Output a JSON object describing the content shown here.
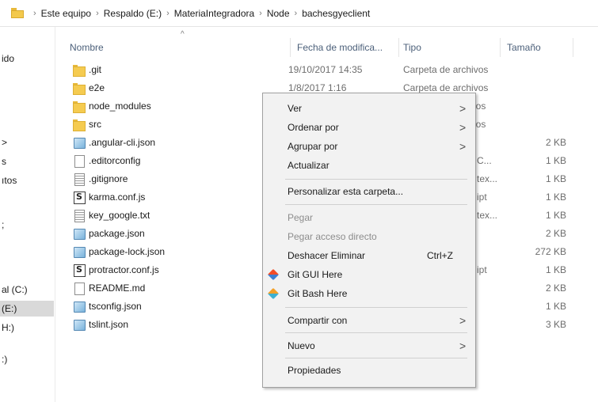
{
  "breadcrumb": {
    "items": [
      "Este equipo",
      "Respaldo (E:)",
      "MateriaIntegradora",
      "Node",
      "bachesgyeclient"
    ]
  },
  "nav": {
    "items": [
      "ido",
      ">",
      "s",
      "ıtos",
      ";",
      "al (C:)",
      "(E:)",
      "H:)",
      ":)"
    ]
  },
  "columns": {
    "name": "Nombre",
    "date": "Fecha de modifica...",
    "type": "Tipo",
    "size": "Tamaño"
  },
  "files": [
    {
      "name": ".git",
      "date": "19/10/2017 14:35",
      "type": "Carpeta de archivos",
      "size": "",
      "icon": "folder-icon"
    },
    {
      "name": "e2e",
      "date": "1/8/2017 1:16",
      "type": "Carpeta de archivos",
      "size": "",
      "icon": "folder-icon"
    },
    {
      "name": "node_modules",
      "date": "",
      "type": "ivos",
      "size": "",
      "icon": "folder-icon"
    },
    {
      "name": "src",
      "date": "",
      "type": "ivos",
      "size": "",
      "icon": "folder-icon"
    },
    {
      "name": ".angular-cli.json",
      "date": "",
      "type": "",
      "size": "2 KB",
      "icon": "json-file-icon"
    },
    {
      "name": ".editorconfig",
      "date": "",
      "type": "C...",
      "size": "1 KB",
      "icon": "file-icon"
    },
    {
      "name": ".gitignore",
      "date": "",
      "type": "tex...",
      "size": "1 KB",
      "icon": "text-file-icon"
    },
    {
      "name": "karma.conf.js",
      "date": "",
      "type": "ipt",
      "size": "1 KB",
      "icon": "js-file-icon"
    },
    {
      "name": "key_google.txt",
      "date": "",
      "type": "tex...",
      "size": "1 KB",
      "icon": "text-file-icon"
    },
    {
      "name": "package.json",
      "date": "",
      "type": "",
      "size": "2 KB",
      "icon": "json-file-icon"
    },
    {
      "name": "package-lock.json",
      "date": "",
      "type": "",
      "size": "272 KB",
      "icon": "json-file-icon"
    },
    {
      "name": "protractor.conf.js",
      "date": "",
      "type": "ipt",
      "size": "1 KB",
      "icon": "js-file-icon"
    },
    {
      "name": "README.md",
      "date": "",
      "type": "",
      "size": "2 KB",
      "icon": "file-icon"
    },
    {
      "name": "tsconfig.json",
      "date": "",
      "type": "",
      "size": "1 KB",
      "icon": "json-file-icon"
    },
    {
      "name": "tslint.json",
      "date": "",
      "type": "",
      "size": "3 KB",
      "icon": "json-file-icon"
    }
  ],
  "context_menu": {
    "ver": "Ver",
    "ordenar": "Ordenar por",
    "agrupar": "Agrupar por",
    "actualizar": "Actualizar",
    "personalizar": "Personalizar esta carpeta...",
    "pegar": "Pegar",
    "pegar_acceso": "Pegar acceso directo",
    "deshacer": "Deshacer Eliminar",
    "deshacer_shortcut": "Ctrl+Z",
    "git_gui": "Git GUI Here",
    "git_bash": "Git Bash Here",
    "compartir": "Compartir con",
    "nuevo": "Nuevo",
    "propiedades": "Propiedades",
    "submenu_arrow": ">"
  },
  "colors": {
    "folder": "#f5cb50",
    "header_text": "#4c607a",
    "menu_bg": "#f2f2f2",
    "selected_nav": "#d9d9d9"
  }
}
